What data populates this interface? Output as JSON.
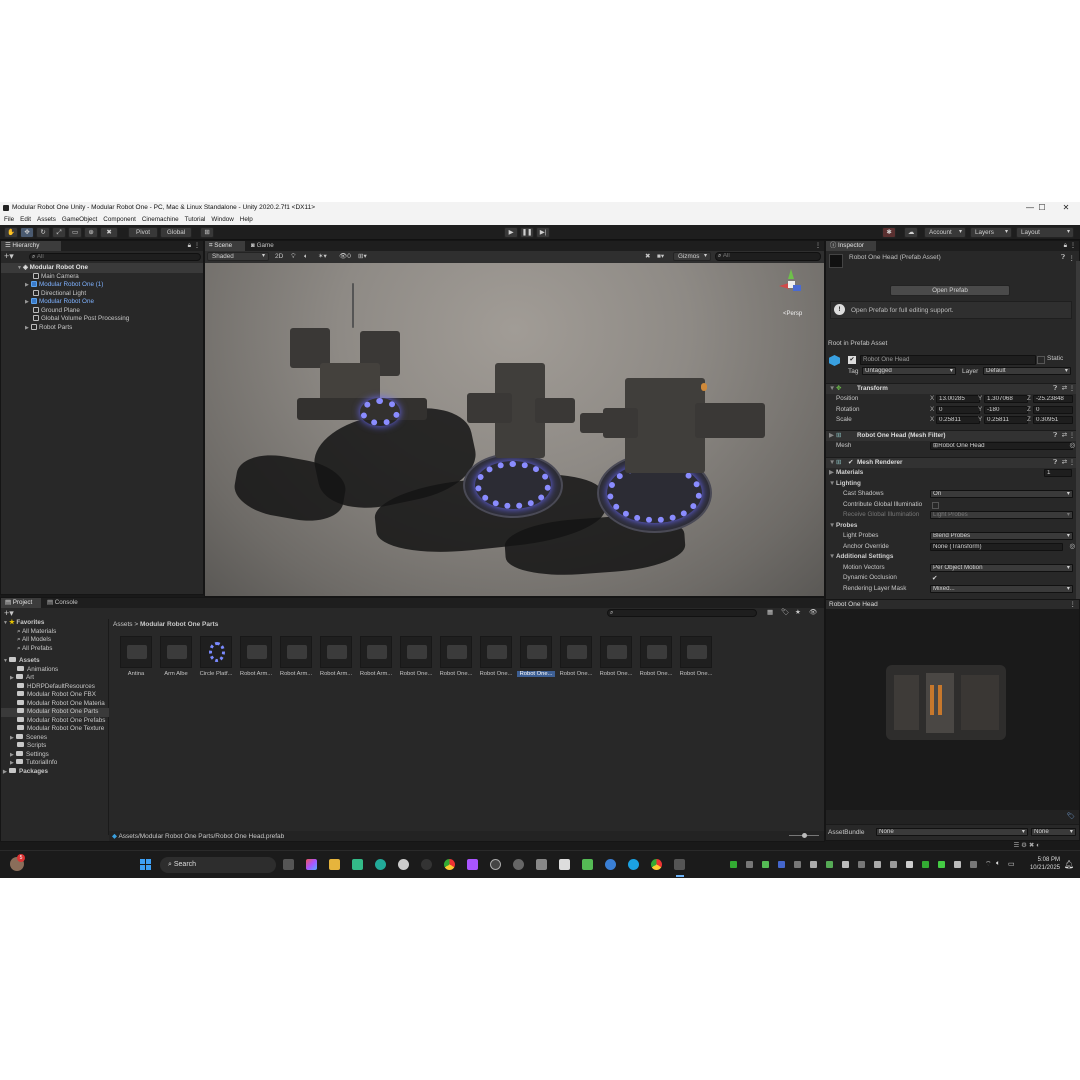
{
  "window": {
    "title": "Modular Robot One Unity - Modular Robot One - PC, Mac & Linux Standalone - Unity 2020.2.7f1 <DX11>",
    "minimize": "—",
    "maximize": "☐",
    "close": "✕"
  },
  "menu": [
    "File",
    "Edit",
    "Assets",
    "GameObject",
    "Component",
    "Cinemachine",
    "Tutorial",
    "Window",
    "Help"
  ],
  "toolbar": {
    "pivot": "Pivot",
    "global": "Global",
    "account": "Account",
    "layers": "Layers",
    "layout": "Layout"
  },
  "hierarchy": {
    "tab": "Hierarchy",
    "search_placeholder": "All",
    "items": [
      {
        "label": "Modular Robot One",
        "indent": 0
      },
      {
        "label": "Main Camera",
        "indent": 1
      },
      {
        "label": "Modular Robot One (1)",
        "indent": 1
      },
      {
        "label": "Directional Light",
        "indent": 1
      },
      {
        "label": "Modular Robot One",
        "indent": 1
      },
      {
        "label": "Ground Plane",
        "indent": 1
      },
      {
        "label": "Global Volume Post Processing",
        "indent": 1
      },
      {
        "label": "Robot Parts",
        "indent": 1
      }
    ]
  },
  "scene": {
    "tab_scene": "Scene",
    "tab_game": "Game",
    "shading": "Shaded",
    "mode_2d": "2D",
    "gizmos": "Gizmos",
    "search": "All",
    "persp": "<Persp"
  },
  "inspector": {
    "tab": "Inspector",
    "asset_title": "Robot One Head (Prefab Asset)",
    "open_prefab": "Open Prefab",
    "info": "Open Prefab for full editing support.",
    "root_label": "Root in Prefab Asset",
    "object_name": "Robot One Head",
    "static": "Static",
    "tag_label": "Tag",
    "tag_value": "Untagged",
    "layer_label": "Layer",
    "layer_value": "Default",
    "transform": {
      "title": "Transform",
      "position_label": "Position",
      "rotation_label": "Rotation",
      "scale_label": "Scale",
      "position": {
        "x": "13.00285",
        "y": "1.307068",
        "z": "-25.23848"
      },
      "rotation": {
        "x": "0",
        "y": "-180",
        "z": "0"
      },
      "scale": {
        "x": "0.25811",
        "y": "0.25811",
        "z": "0.30951"
      }
    },
    "mesh_filter": {
      "title": "Robot One Head (Mesh Filter)",
      "mesh_label": "Mesh",
      "mesh_value": "Robot One Head"
    },
    "mesh_renderer": {
      "title": "Mesh Renderer",
      "materials_label": "Materials",
      "materials_count": "1",
      "lighting": "Lighting",
      "cast_shadows_label": "Cast Shadows",
      "cast_shadows_value": "On",
      "contribute_gi": "Contribute Global Illuminatio",
      "receive_gi_label": "Receive Global Illumination",
      "receive_gi_value": "Light Probes",
      "probes": "Probes",
      "light_probes_label": "Light Probes",
      "light_probes_value": "Blend Probes",
      "anchor_override_label": "Anchor Override",
      "anchor_override_value": "None (Transform)",
      "additional": "Additional Settings",
      "motion_vectors_label": "Motion Vectors",
      "motion_vectors_value": "Per Object Motion",
      "dynamic_occlusion_label": "Dynamic Occlusion",
      "rendering_layer_label": "Rendering Layer Mask",
      "rendering_layer_value": "Mixed..."
    },
    "preview_title": "Robot One Head",
    "assetbundle_label": "AssetBundle",
    "assetbundle_value": "None",
    "assetbundle_variant": "None"
  },
  "project": {
    "tab_project": "Project",
    "tab_console": "Console",
    "favorites_label": "Favorites",
    "favorites": [
      "All Materials",
      "All Models",
      "All Prefabs"
    ],
    "assets_label": "Assets",
    "folders": [
      "Animations",
      "Art",
      "HDRPDefaultResources",
      "Modular Robot One FBX",
      "Modular Robot One Materia",
      "Modular Robot One Parts",
      "Modular Robot One Prefabs",
      "Modular Robot One Texture",
      "Scenes",
      "Scripts",
      "Settings",
      "TutorialInfo"
    ],
    "packages_label": "Packages",
    "breadcrumb_root": "Assets",
    "breadcrumb_sep": ">",
    "breadcrumb_current": "Modular Robot One Parts",
    "assets": [
      "Antina",
      "Arm Albe",
      "Circle Platf...",
      "Robot Arm...",
      "Robot Arm...",
      "Robot Arm...",
      "Robot Arm...",
      "Robot One...",
      "Robot One...",
      "Robot One...",
      "Robot One...",
      "Robot One...",
      "Robot One...",
      "Robot One...",
      "Robot One..."
    ],
    "selected_index": 10,
    "footer_path": "Assets/Modular Robot One Parts/Robot One Head.prefab"
  },
  "taskbar": {
    "search": "Search",
    "notification_count": "5",
    "time": "5:08 PM",
    "date": "10/21/2025"
  }
}
